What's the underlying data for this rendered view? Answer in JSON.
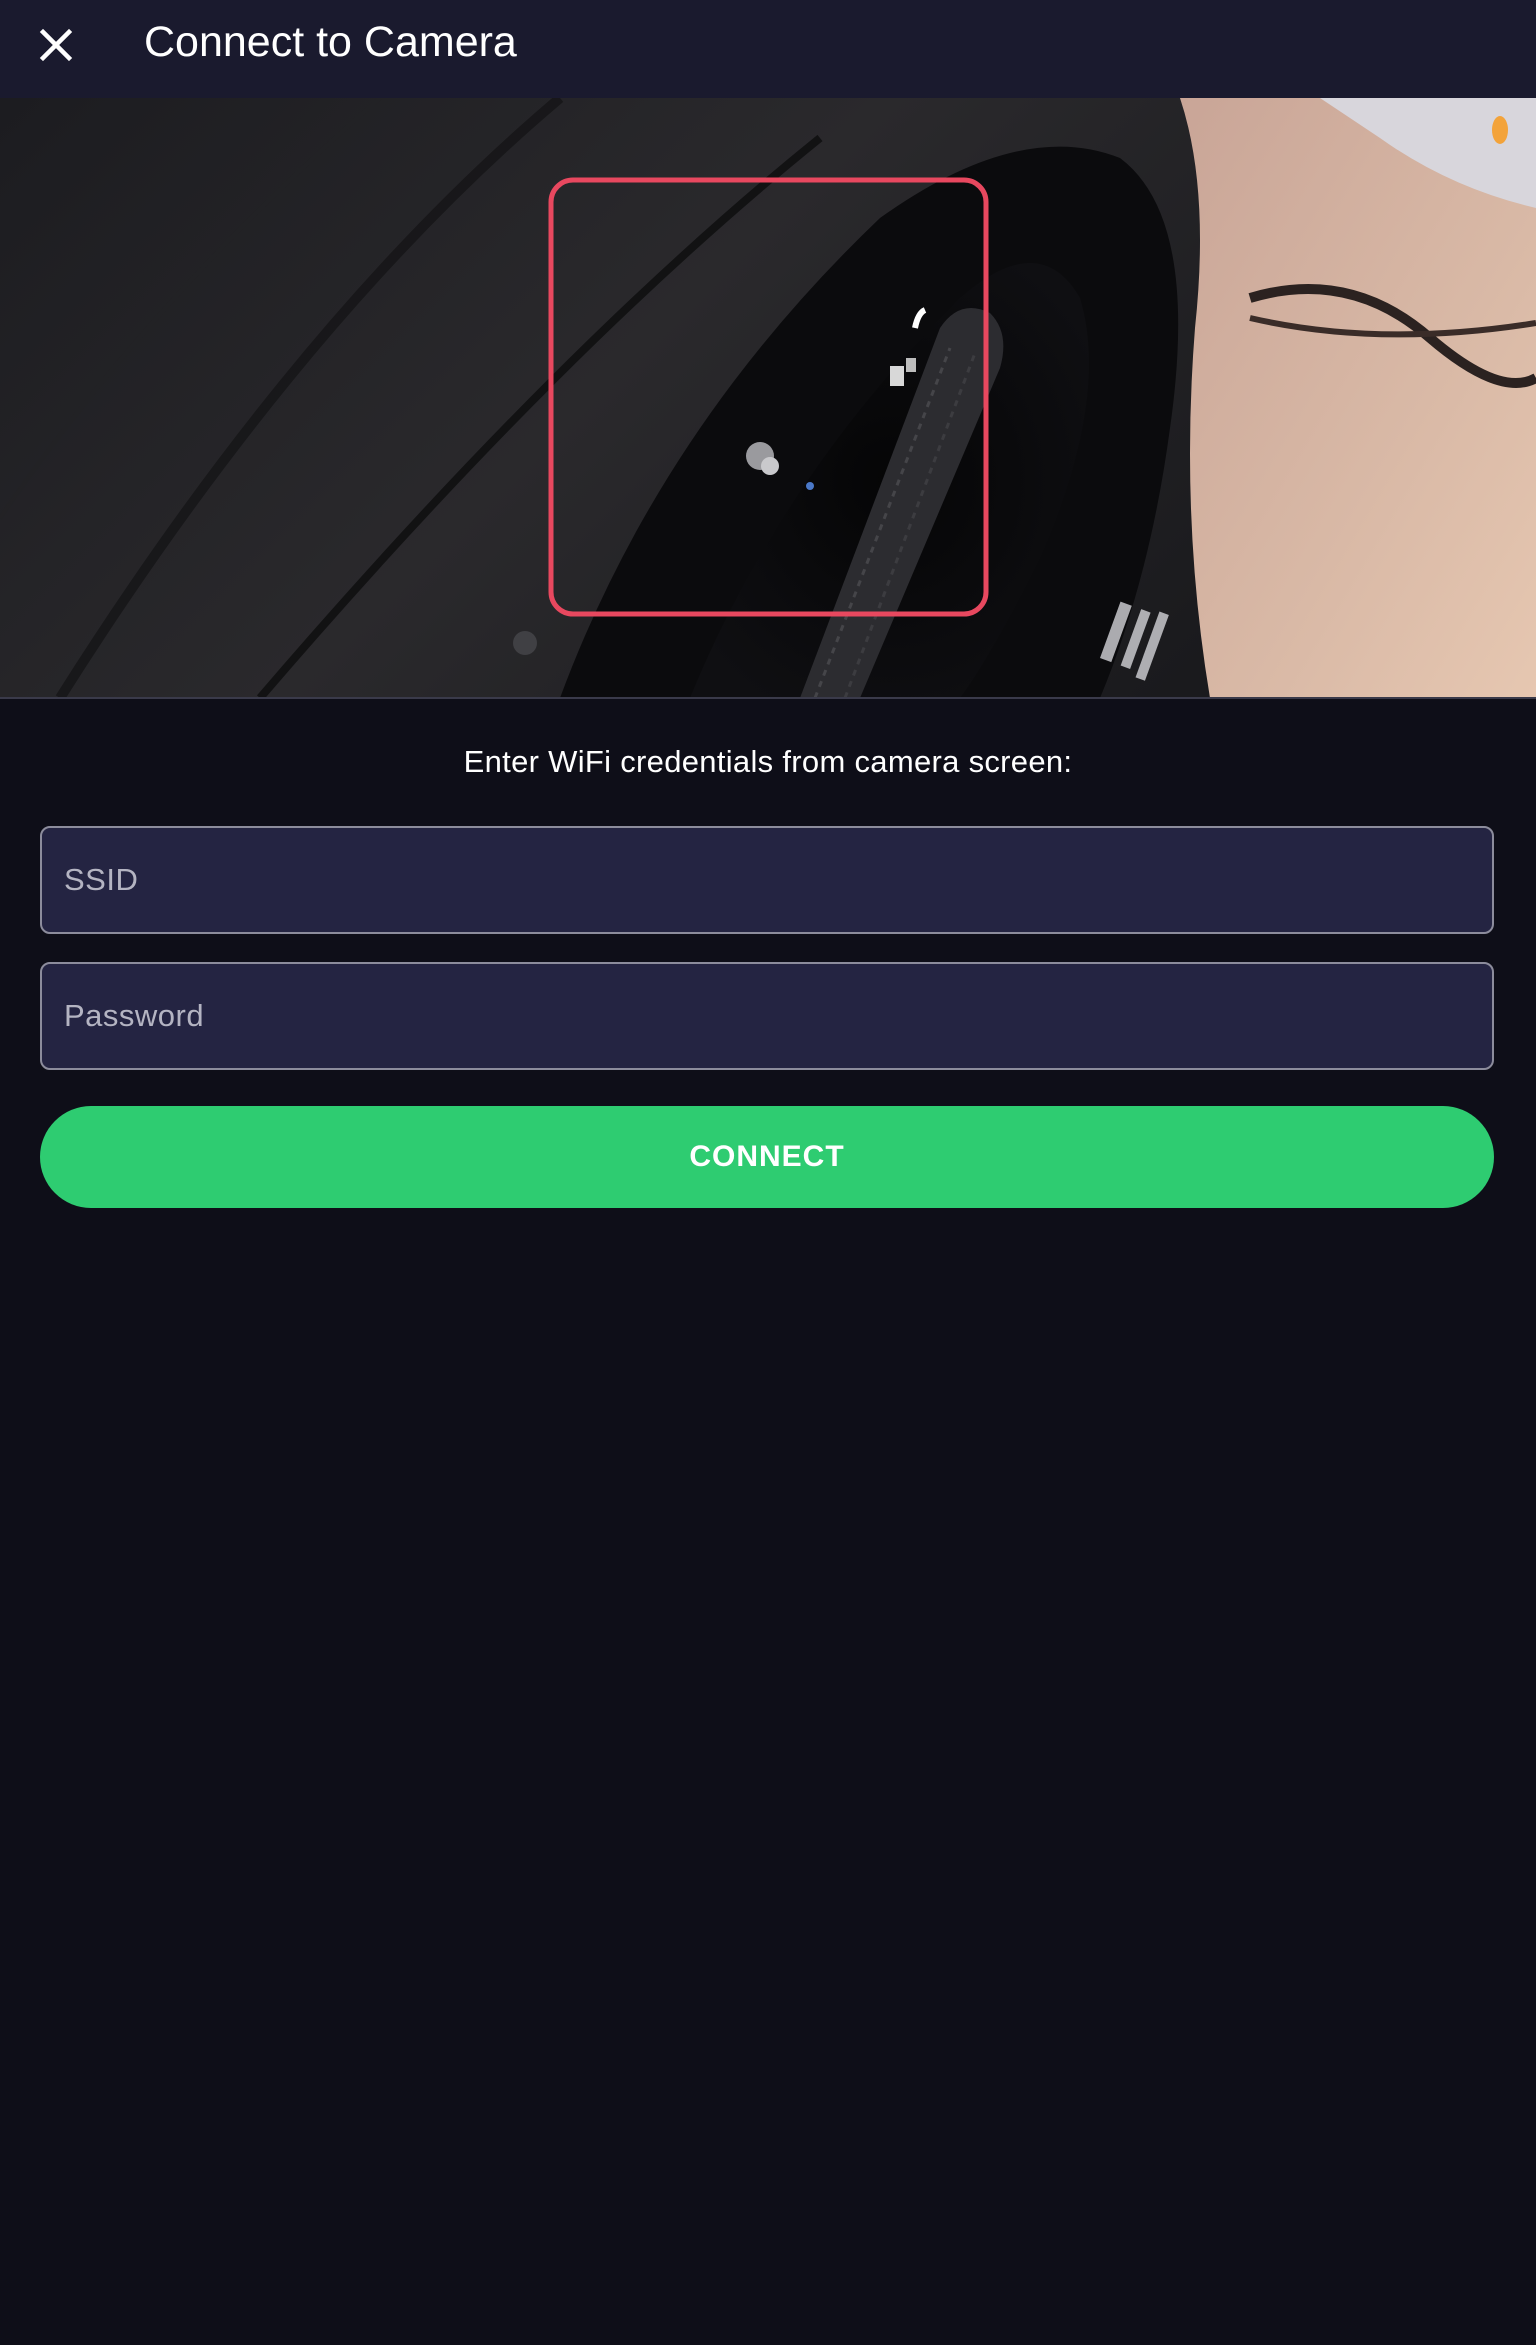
{
  "header": {
    "title": "Connect to Camera",
    "close_icon": "close-icon"
  },
  "camera_preview": {
    "target_frame_color": "#e8485f"
  },
  "form": {
    "instruction": "Enter WiFi credentials from camera screen:",
    "ssid": {
      "value": "",
      "placeholder": "SSID"
    },
    "password": {
      "value": "",
      "placeholder": "Password"
    },
    "connect_label": "CONNECT"
  },
  "colors": {
    "app_bar": "#1a1a2e",
    "background": "#0e0e18",
    "field_background": "#242442",
    "connect_button": "#2ecc71"
  }
}
